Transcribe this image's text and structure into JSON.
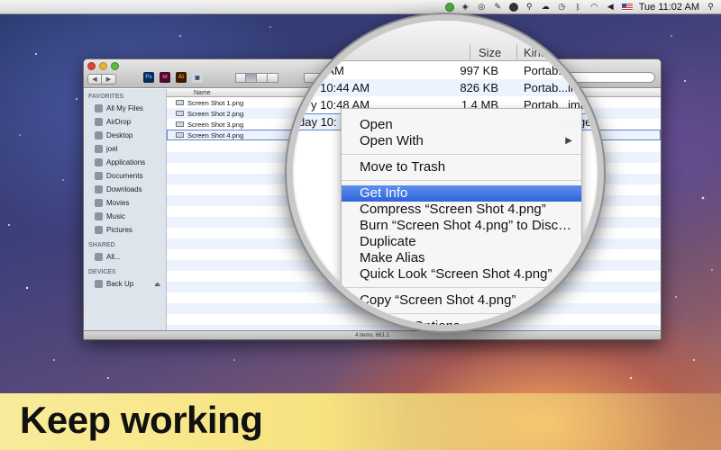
{
  "menubar": {
    "clock": "Tue 11:02 AM"
  },
  "window": {
    "sidebar": {
      "favorites_heading": "FAVORITES",
      "favorites": [
        {
          "label": "All My Files",
          "icon": "all-files-icon"
        },
        {
          "label": "AirDrop",
          "icon": "airdrop-icon"
        },
        {
          "label": "Desktop",
          "icon": "desktop-icon"
        },
        {
          "label": "joel",
          "icon": "home-icon"
        },
        {
          "label": "Applications",
          "icon": "applications-icon"
        },
        {
          "label": "Documents",
          "icon": "documents-icon"
        },
        {
          "label": "Downloads",
          "icon": "downloads-icon"
        },
        {
          "label": "Movies",
          "icon": "movies-icon"
        },
        {
          "label": "Music",
          "icon": "music-icon"
        },
        {
          "label": "Pictures",
          "icon": "pictures-icon"
        }
      ],
      "shared_heading": "SHARED",
      "shared": [
        {
          "label": "All...",
          "icon": "network-icon"
        }
      ],
      "devices_heading": "DEVICES",
      "devices": [
        {
          "label": "Back Up",
          "icon": "disk-icon"
        }
      ]
    },
    "column_name": "Name",
    "files": [
      "Screen Shot 1.png",
      "Screen Shot 2.png",
      "Screen Shot 3.png",
      "Screen Shot 4.png"
    ],
    "status": "4 items, 661.1"
  },
  "magnifier": {
    "header_size": "Size",
    "header_kind": "Kind",
    "rows": [
      {
        "date": "36 AM",
        "size": "997 KB",
        "kind": "Portab...image"
      },
      {
        "date": "y 10:44 AM",
        "size": "826 KB",
        "kind": "Portab...ima"
      },
      {
        "date": "y 10:48 AM",
        "size": "1.4 MB",
        "kind": "Portab...imag"
      },
      {
        "date": "day 10:",
        "size": "",
        "kind": "image"
      }
    ],
    "menu": {
      "open": "Open",
      "open_with": "Open With",
      "move_to_trash": "Move to Trash",
      "get_info": "Get Info",
      "compress": "Compress “Screen Shot 4.png”",
      "burn": "Burn “Screen Shot 4.png” to Disc…",
      "duplicate": "Duplicate",
      "make_alias": "Make Alias",
      "quick_look": "Quick Look “Screen Shot 4.png”",
      "copy": "Copy “Screen Shot 4.png”",
      "view_options": "ow View Options"
    }
  },
  "banner": {
    "text": "Keep working"
  }
}
